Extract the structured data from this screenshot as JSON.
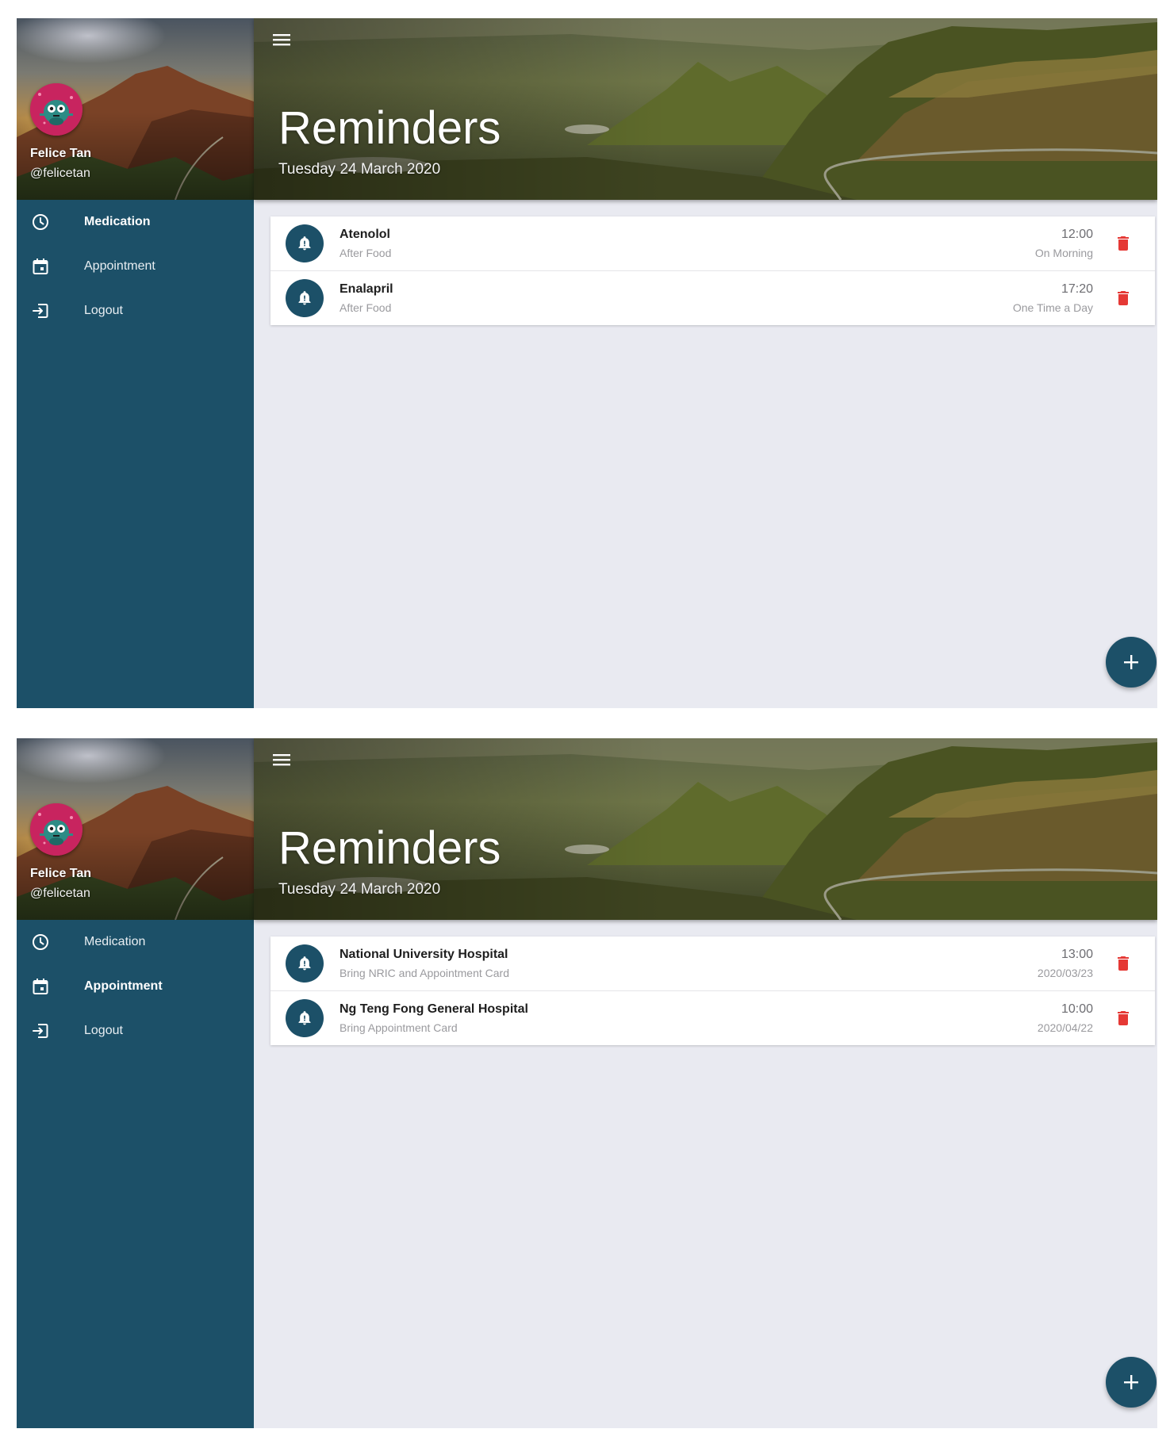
{
  "colors": {
    "sidebar": "#1c5068",
    "background": "#e9eaf1",
    "delete": "#e53935",
    "accent": "#1c5068"
  },
  "icons": {
    "menu": "menu-icon",
    "medication": "clock-icon",
    "appointment": "calendar-icon",
    "logout": "logout-icon",
    "reminder": "bell-icon",
    "delete": "trash-icon",
    "add": "plus-icon"
  },
  "screens": [
    {
      "user": {
        "name": "Felice Tan",
        "handle": "@felicetan"
      },
      "nav": [
        {
          "label": "Medication",
          "icon": "clock-icon",
          "active": true
        },
        {
          "label": "Appointment",
          "icon": "calendar-icon",
          "active": false
        },
        {
          "label": "Logout",
          "icon": "logout-icon",
          "active": false
        }
      ],
      "header": {
        "title": "Reminders",
        "date": "Tuesday 24 March 2020"
      },
      "items": [
        {
          "title": "Atenolol",
          "subtitle": "After Food",
          "time": "12:00",
          "meta": "On Morning"
        },
        {
          "title": "Enalapril",
          "subtitle": "After Food",
          "time": "17:20",
          "meta": "One Time a Day"
        }
      ]
    },
    {
      "user": {
        "name": "Felice Tan",
        "handle": "@felicetan"
      },
      "nav": [
        {
          "label": "Medication",
          "icon": "clock-icon",
          "active": false
        },
        {
          "label": "Appointment",
          "icon": "calendar-icon",
          "active": true
        },
        {
          "label": "Logout",
          "icon": "logout-icon",
          "active": false
        }
      ],
      "header": {
        "title": "Reminders",
        "date": "Tuesday 24 March 2020"
      },
      "items": [
        {
          "title": "National University Hospital",
          "subtitle": "Bring NRIC and Appointment Card",
          "time": "13:00",
          "meta": "2020/03/23"
        },
        {
          "title": "Ng Teng Fong General Hospital",
          "subtitle": "Bring Appointment Card",
          "time": "10:00",
          "meta": "2020/04/22"
        }
      ]
    }
  ]
}
